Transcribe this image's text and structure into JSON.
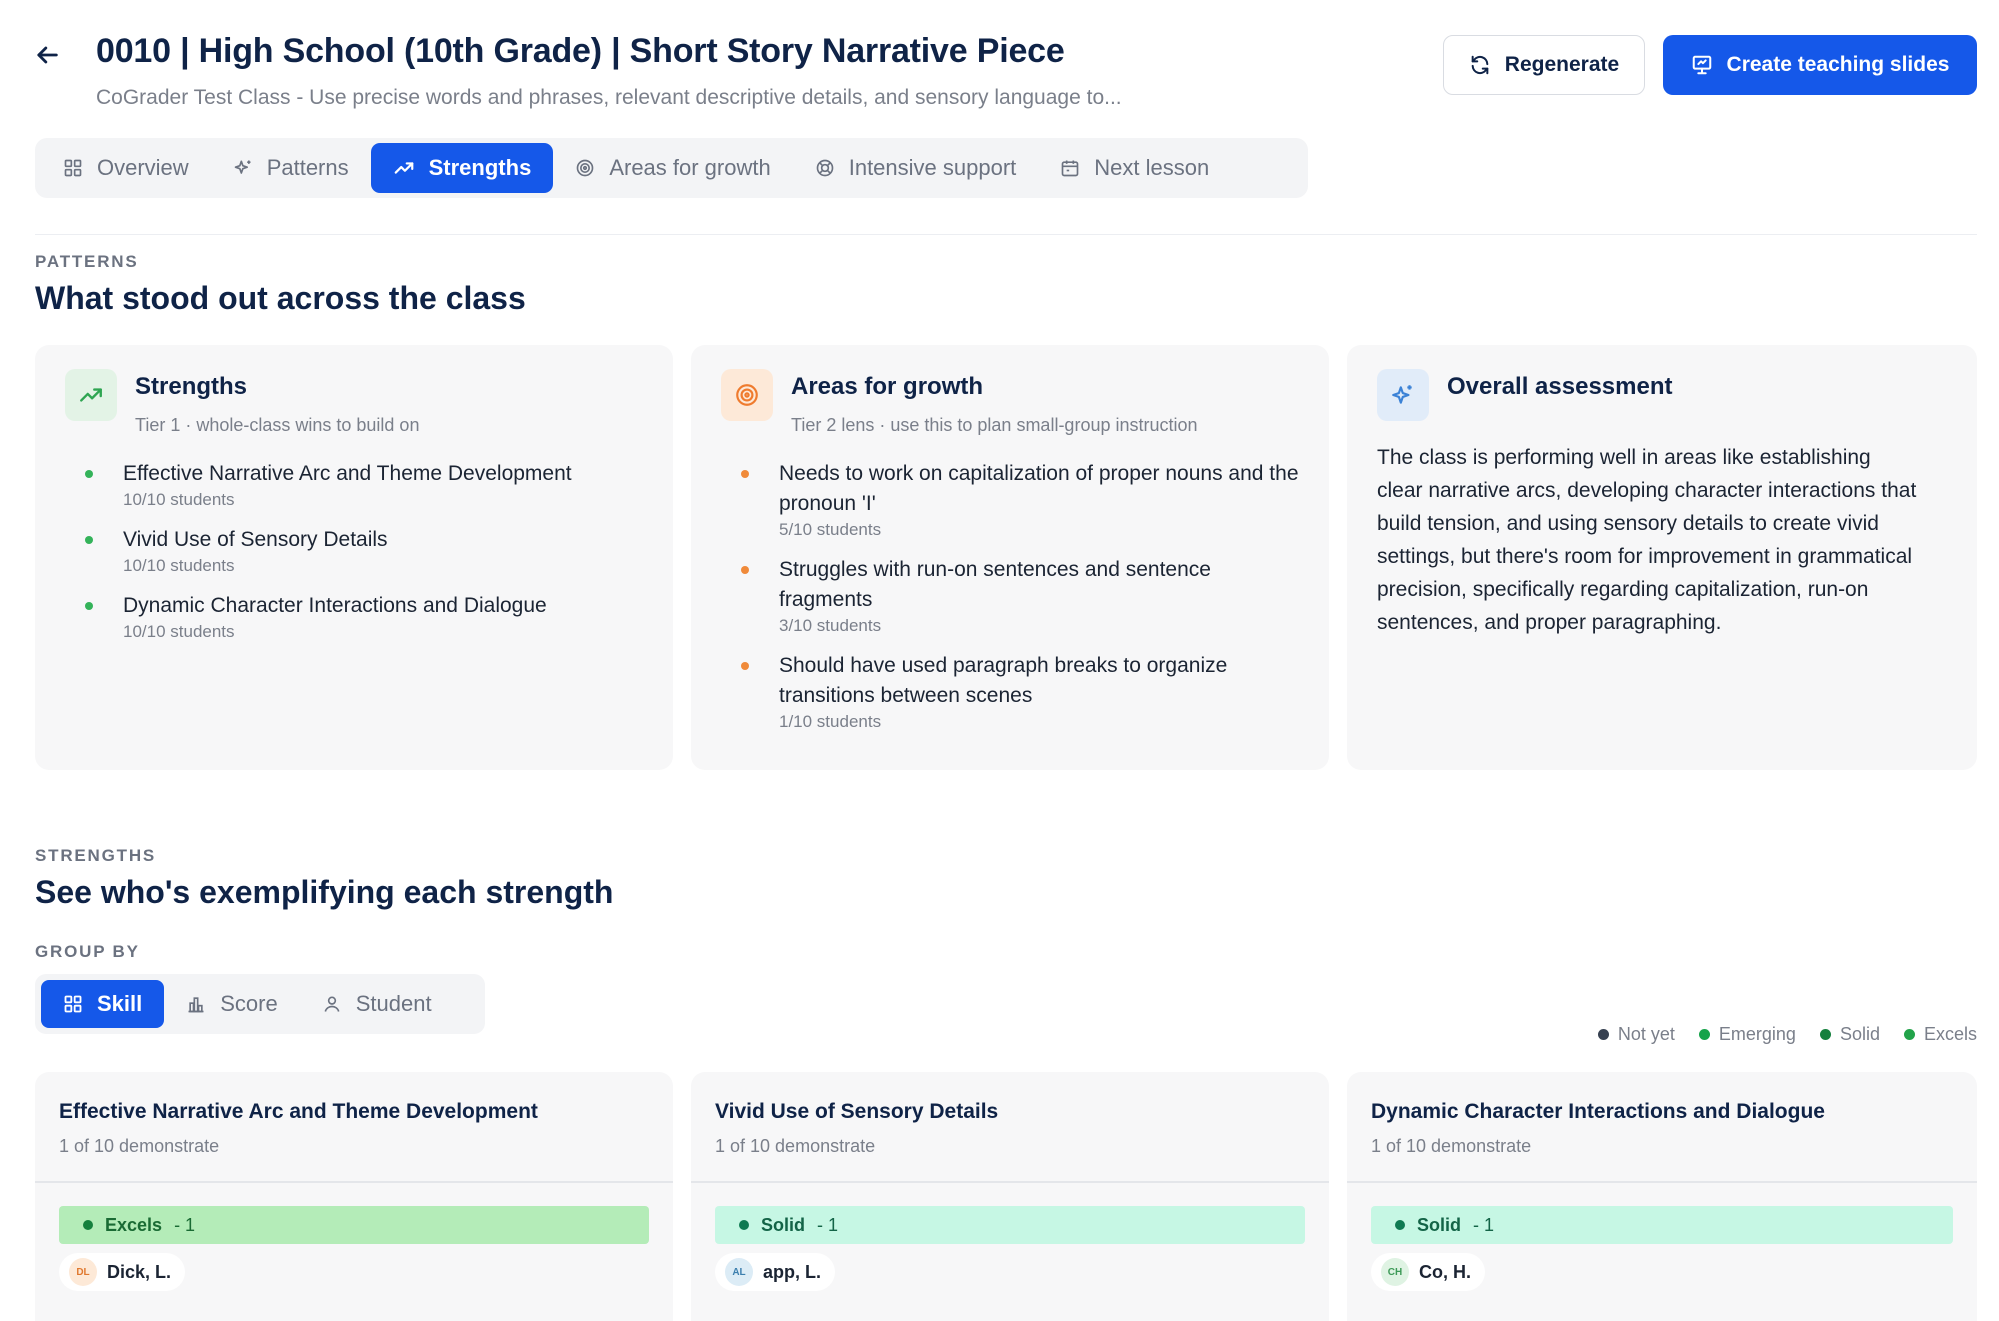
{
  "header": {
    "title": "0010 | High School (10th Grade) | Short Story Narrative Piece",
    "subtitle": "CoGrader Test Class - Use precise words and phrases, relevant descriptive details, and sensory language to...",
    "regenerate_label": "Regenerate",
    "create_slides_label": "Create teaching slides"
  },
  "tabs": [
    {
      "label": "Overview",
      "icon": "grid-icon",
      "active": false
    },
    {
      "label": "Patterns",
      "icon": "sparkles-icon",
      "active": false
    },
    {
      "label": "Strengths",
      "icon": "trending-up-icon",
      "active": true
    },
    {
      "label": "Areas for growth",
      "icon": "target-icon",
      "active": false
    },
    {
      "label": "Intensive support",
      "icon": "lifebuoy-icon",
      "active": false
    },
    {
      "label": "Next lesson",
      "icon": "calendar-icon",
      "active": false
    }
  ],
  "patterns": {
    "eyebrow": "PATTERNS",
    "heading": "What stood out across the class",
    "strengths": {
      "title": "Strengths",
      "subtitle": "Tier 1 · whole-class wins to build on",
      "items": [
        {
          "label": "Effective Narrative Arc and Theme Development",
          "count": "10/10 students"
        },
        {
          "label": "Vivid Use of Sensory Details",
          "count": "10/10 students"
        },
        {
          "label": "Dynamic Character Interactions and Dialogue",
          "count": "10/10 students"
        }
      ]
    },
    "growth": {
      "title": "Areas for growth",
      "subtitle": "Tier 2 lens · use this to plan small-group instruction",
      "items": [
        {
          "label": "Needs to work on capitalization of proper nouns and the pronoun 'I'",
          "count": "5/10 students"
        },
        {
          "label": "Struggles with run-on sentences and sentence fragments",
          "count": "3/10 students"
        },
        {
          "label": "Should have used paragraph breaks to organize transitions between scenes",
          "count": "1/10 students"
        }
      ]
    },
    "overall": {
      "title": "Overall assessment",
      "text": "The class is performing well in areas like establishing clear narrative arcs, developing character interactions that build tension, and using sensory details to create vivid settings, but there's room for improvement in grammatical precision, specifically regarding capitalization, run-on sentences, and proper paragraphing."
    }
  },
  "strengths_section": {
    "eyebrow": "STRENGTHS",
    "heading": "See who's exemplifying each strength",
    "group_by_label": "GROUP BY",
    "group_options": [
      {
        "label": "Skill",
        "icon": "grid-icon",
        "active": true
      },
      {
        "label": "Score",
        "icon": "bar-chart-icon",
        "active": false
      },
      {
        "label": "Student",
        "icon": "user-icon",
        "active": false
      }
    ],
    "legend": [
      {
        "label": "Not yet",
        "color": "#374151"
      },
      {
        "label": "Emerging",
        "color": "#16a34a"
      },
      {
        "label": "Solid",
        "color": "#15803d"
      },
      {
        "label": "Excels",
        "color": "#22a34a"
      }
    ],
    "cards": [
      {
        "title": "Effective Narrative Arc and Theme Development",
        "subtitle": "1 of 10 demonstrate",
        "level": "Excels",
        "level_count": "- 1",
        "bar_color": "#b4ecb8",
        "text_color": "#1a6b34",
        "dot_color": "#15803d",
        "student": {
          "initials": "DL",
          "name": "Dick, L.",
          "avatar_bg": "#fde9d7",
          "avatar_fg": "#e0782e"
        }
      },
      {
        "title": "Vivid Use of Sensory Details",
        "subtitle": "1 of 10 demonstrate",
        "level": "Solid",
        "level_count": "- 1",
        "bar_color": "#c6f7e4",
        "text_color": "#136447",
        "dot_color": "#0f7a52",
        "student": {
          "initials": "AL",
          "name": "app, L.",
          "avatar_bg": "#dcecf6",
          "avatar_fg": "#3c7fae"
        }
      },
      {
        "title": "Dynamic Character Interactions and Dialogue",
        "subtitle": "1 of 10 demonstrate",
        "level": "Solid",
        "level_count": "- 1",
        "bar_color": "#c6f7e4",
        "text_color": "#136447",
        "dot_color": "#0f7a52",
        "student": {
          "initials": "CH",
          "name": "Co, H.",
          "avatar_bg": "#dff3e3",
          "avatar_fg": "#3d9a57"
        }
      }
    ]
  }
}
